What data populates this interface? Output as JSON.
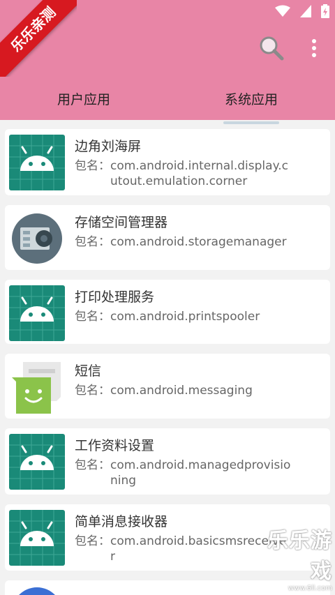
{
  "ribbon": {
    "text": "乐乐亲测"
  },
  "tabs": [
    {
      "label": "用户应用",
      "selected": false
    },
    {
      "label": "系统应用",
      "selected": true
    }
  ],
  "apps": [
    {
      "name": "边角刘海屏",
      "pkg_label": "包名：",
      "pkg": "com.android.internal.display.cutout.emulation.corner",
      "icon": "android-robot-icon"
    },
    {
      "name": "存储空间管理器",
      "pkg_label": "包名：",
      "pkg": "com.android.storagemanager",
      "icon": "storage-manager-icon"
    },
    {
      "name": "打印处理服务",
      "pkg_label": "包名：",
      "pkg": "com.android.printspooler",
      "icon": "android-robot-icon"
    },
    {
      "name": "短信",
      "pkg_label": "包名：",
      "pkg": "com.android.messaging",
      "icon": "messaging-icon"
    },
    {
      "name": "工作资料设置",
      "pkg_label": "包名：",
      "pkg": "com.android.managedprovisioning",
      "icon": "android-robot-icon"
    },
    {
      "name": "简单消息接收器",
      "pkg_label": "包名：",
      "pkg": "com.android.basicsmsreceiver",
      "icon": "android-robot-icon"
    }
  ],
  "watermark": {
    "title": "乐乐游戏",
    "url": "www.6ll.com"
  },
  "colors": {
    "header": "#e885a6",
    "android_tile": "#1a8a78",
    "ribbon": "#d71920"
  }
}
